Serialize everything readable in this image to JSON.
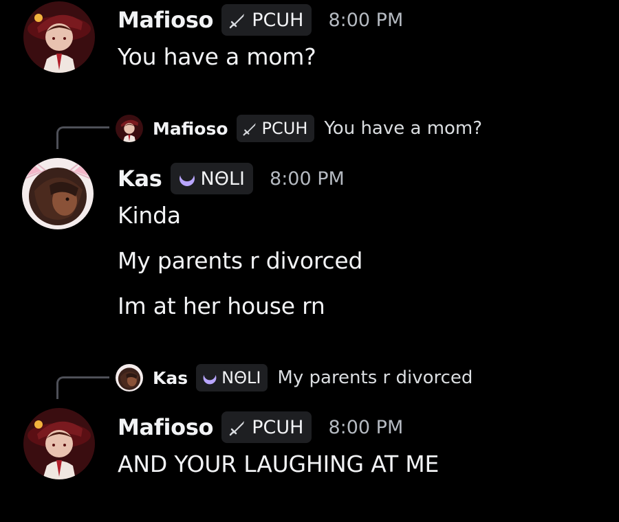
{
  "messages": [
    {
      "author": "Mafioso",
      "tag_label": "PCUH",
      "tag_icon": "sword-icon",
      "timestamp": "8:00 PM",
      "lines": [
        "You have a mom?"
      ]
    },
    {
      "reply": {
        "author": "Mafioso",
        "tag_label": "PCUH",
        "tag_icon": "sword-icon",
        "text": "You have a mom?"
      },
      "author": "Kas",
      "tag_label": "NΘLI",
      "tag_icon": "moon-icon",
      "timestamp": "8:00 PM",
      "lines": [
        "Kinda",
        "My parents r divorced",
        "Im at her house rn"
      ]
    },
    {
      "reply": {
        "author": "Kas",
        "tag_label": "NΘLI",
        "tag_icon": "moon-icon",
        "text": "My parents r divorced"
      },
      "author": "Mafioso",
      "tag_label": "PCUH",
      "tag_icon": "sword-icon",
      "timestamp": "8:00 PM",
      "lines": [
        "AND YOUR LAUGHING AT ME"
      ]
    }
  ],
  "colors": {
    "background": "#000000",
    "text": "#f2f3f5",
    "muted": "#b5bac1",
    "tag_bg": "#1e1f22",
    "moon_accent": "#b9a6ff"
  }
}
